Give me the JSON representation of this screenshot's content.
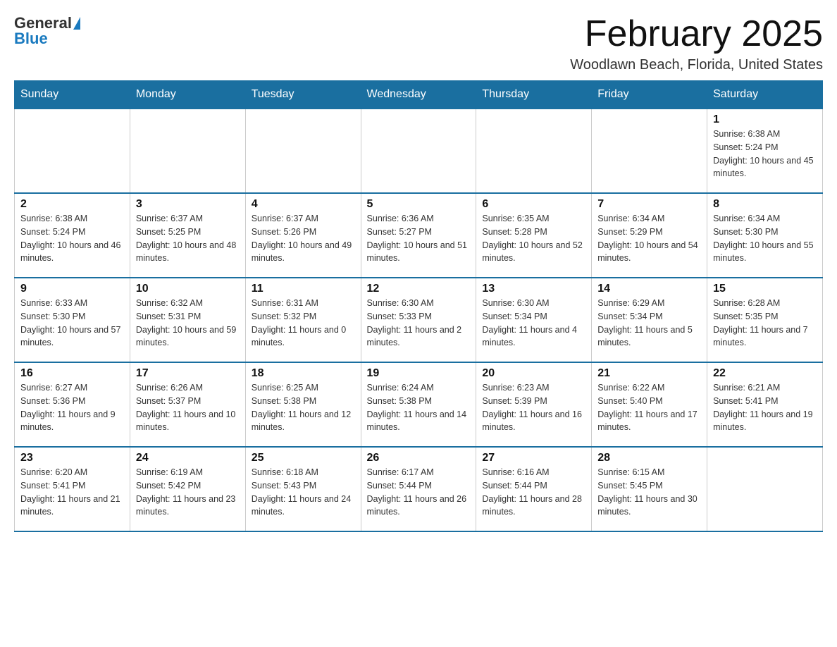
{
  "logo": {
    "text1": "General",
    "text2": "Blue"
  },
  "header": {
    "month": "February 2025",
    "location": "Woodlawn Beach, Florida, United States"
  },
  "days_of_week": [
    "Sunday",
    "Monday",
    "Tuesday",
    "Wednesday",
    "Thursday",
    "Friday",
    "Saturday"
  ],
  "weeks": [
    {
      "days": [
        {
          "num": "",
          "info": ""
        },
        {
          "num": "",
          "info": ""
        },
        {
          "num": "",
          "info": ""
        },
        {
          "num": "",
          "info": ""
        },
        {
          "num": "",
          "info": ""
        },
        {
          "num": "",
          "info": ""
        },
        {
          "num": "1",
          "info": "Sunrise: 6:38 AM\nSunset: 5:24 PM\nDaylight: 10 hours and 45 minutes."
        }
      ]
    },
    {
      "days": [
        {
          "num": "2",
          "info": "Sunrise: 6:38 AM\nSunset: 5:24 PM\nDaylight: 10 hours and 46 minutes."
        },
        {
          "num": "3",
          "info": "Sunrise: 6:37 AM\nSunset: 5:25 PM\nDaylight: 10 hours and 48 minutes."
        },
        {
          "num": "4",
          "info": "Sunrise: 6:37 AM\nSunset: 5:26 PM\nDaylight: 10 hours and 49 minutes."
        },
        {
          "num": "5",
          "info": "Sunrise: 6:36 AM\nSunset: 5:27 PM\nDaylight: 10 hours and 51 minutes."
        },
        {
          "num": "6",
          "info": "Sunrise: 6:35 AM\nSunset: 5:28 PM\nDaylight: 10 hours and 52 minutes."
        },
        {
          "num": "7",
          "info": "Sunrise: 6:34 AM\nSunset: 5:29 PM\nDaylight: 10 hours and 54 minutes."
        },
        {
          "num": "8",
          "info": "Sunrise: 6:34 AM\nSunset: 5:30 PM\nDaylight: 10 hours and 55 minutes."
        }
      ]
    },
    {
      "days": [
        {
          "num": "9",
          "info": "Sunrise: 6:33 AM\nSunset: 5:30 PM\nDaylight: 10 hours and 57 minutes."
        },
        {
          "num": "10",
          "info": "Sunrise: 6:32 AM\nSunset: 5:31 PM\nDaylight: 10 hours and 59 minutes."
        },
        {
          "num": "11",
          "info": "Sunrise: 6:31 AM\nSunset: 5:32 PM\nDaylight: 11 hours and 0 minutes."
        },
        {
          "num": "12",
          "info": "Sunrise: 6:30 AM\nSunset: 5:33 PM\nDaylight: 11 hours and 2 minutes."
        },
        {
          "num": "13",
          "info": "Sunrise: 6:30 AM\nSunset: 5:34 PM\nDaylight: 11 hours and 4 minutes."
        },
        {
          "num": "14",
          "info": "Sunrise: 6:29 AM\nSunset: 5:34 PM\nDaylight: 11 hours and 5 minutes."
        },
        {
          "num": "15",
          "info": "Sunrise: 6:28 AM\nSunset: 5:35 PM\nDaylight: 11 hours and 7 minutes."
        }
      ]
    },
    {
      "days": [
        {
          "num": "16",
          "info": "Sunrise: 6:27 AM\nSunset: 5:36 PM\nDaylight: 11 hours and 9 minutes."
        },
        {
          "num": "17",
          "info": "Sunrise: 6:26 AM\nSunset: 5:37 PM\nDaylight: 11 hours and 10 minutes."
        },
        {
          "num": "18",
          "info": "Sunrise: 6:25 AM\nSunset: 5:38 PM\nDaylight: 11 hours and 12 minutes."
        },
        {
          "num": "19",
          "info": "Sunrise: 6:24 AM\nSunset: 5:38 PM\nDaylight: 11 hours and 14 minutes."
        },
        {
          "num": "20",
          "info": "Sunrise: 6:23 AM\nSunset: 5:39 PM\nDaylight: 11 hours and 16 minutes."
        },
        {
          "num": "21",
          "info": "Sunrise: 6:22 AM\nSunset: 5:40 PM\nDaylight: 11 hours and 17 minutes."
        },
        {
          "num": "22",
          "info": "Sunrise: 6:21 AM\nSunset: 5:41 PM\nDaylight: 11 hours and 19 minutes."
        }
      ]
    },
    {
      "days": [
        {
          "num": "23",
          "info": "Sunrise: 6:20 AM\nSunset: 5:41 PM\nDaylight: 11 hours and 21 minutes."
        },
        {
          "num": "24",
          "info": "Sunrise: 6:19 AM\nSunset: 5:42 PM\nDaylight: 11 hours and 23 minutes."
        },
        {
          "num": "25",
          "info": "Sunrise: 6:18 AM\nSunset: 5:43 PM\nDaylight: 11 hours and 24 minutes."
        },
        {
          "num": "26",
          "info": "Sunrise: 6:17 AM\nSunset: 5:44 PM\nDaylight: 11 hours and 26 minutes."
        },
        {
          "num": "27",
          "info": "Sunrise: 6:16 AM\nSunset: 5:44 PM\nDaylight: 11 hours and 28 minutes."
        },
        {
          "num": "28",
          "info": "Sunrise: 6:15 AM\nSunset: 5:45 PM\nDaylight: 11 hours and 30 minutes."
        },
        {
          "num": "",
          "info": ""
        }
      ]
    }
  ]
}
